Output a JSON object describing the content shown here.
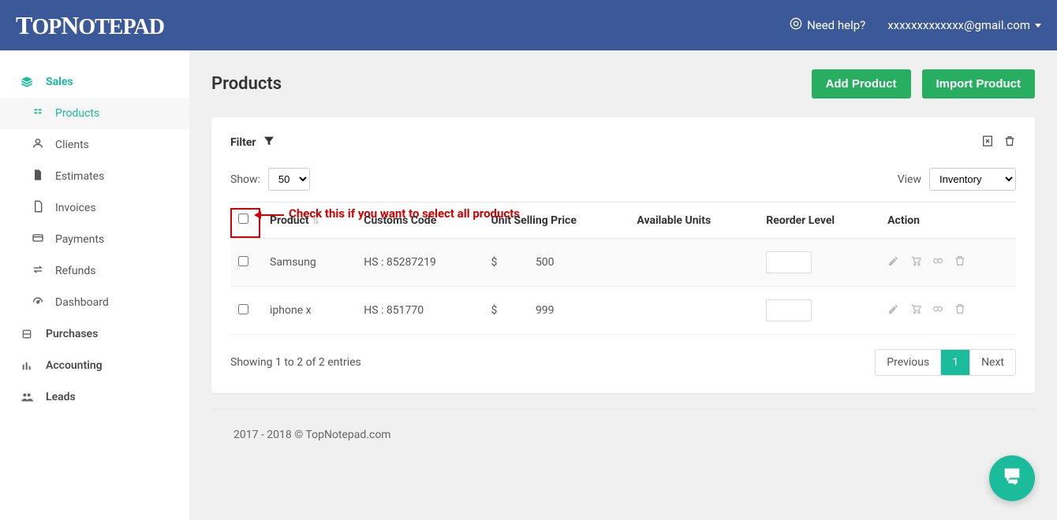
{
  "brand": "TopNotepad",
  "topbar": {
    "help_label": "Need help?",
    "user_email": "xxxxxxxxxxxxx@gmail.com"
  },
  "sidebar": {
    "sales_label": "Sales",
    "items": [
      {
        "label": "Products"
      },
      {
        "label": "Clients"
      },
      {
        "label": "Estimates"
      },
      {
        "label": "Invoices"
      },
      {
        "label": "Payments"
      },
      {
        "label": "Refunds"
      },
      {
        "label": "Dashboard"
      }
    ],
    "purchases_label": "Purchases",
    "accounting_label": "Accounting",
    "leads_label": "Leads"
  },
  "page": {
    "title": "Products",
    "add_button": "Add Product",
    "import_button": "Import Product"
  },
  "filter": {
    "label": "Filter"
  },
  "controls": {
    "show_label": "Show:",
    "show_value": "50",
    "view_label": "View",
    "view_value": "Inventory"
  },
  "annotation": {
    "text": "Check this if you want to select all products"
  },
  "table": {
    "headers": {
      "product": "Product",
      "customs": "Customs Code",
      "unit_price": "Unit Selling Price",
      "available": "Available Units",
      "reorder": "Reorder Level",
      "action": "Action"
    },
    "rows": [
      {
        "product": "Samsung",
        "customs": "HS : 85287219",
        "currency": "$",
        "price": "500",
        "available": ""
      },
      {
        "product": "iphone x",
        "customs": "HS : 851770",
        "currency": "$",
        "price": "999",
        "available": ""
      }
    ]
  },
  "table_footer": {
    "showing": "Showing 1 to 2 of 2 entries",
    "prev": "Previous",
    "page": "1",
    "next": "Next"
  },
  "footer": {
    "copyright": "2017 - 2018 © TopNotepad.com"
  }
}
